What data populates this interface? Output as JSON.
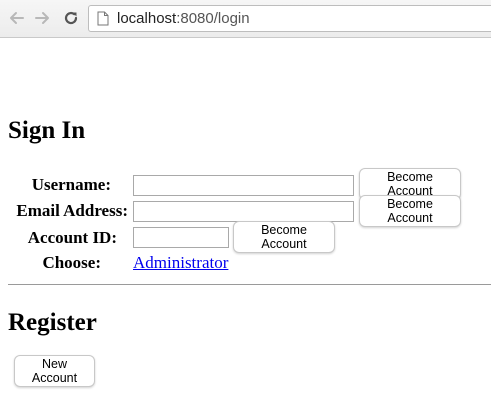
{
  "browser": {
    "url_host": "localhost",
    "url_rest": ":8080/login",
    "icons": {
      "back": "back-arrow-icon",
      "forward": "forward-arrow-icon",
      "reload": "reload-icon",
      "page": "page-icon"
    }
  },
  "signin": {
    "heading": "Sign In",
    "username_label": "Username:",
    "username_value": "",
    "email_label": "Email Address:",
    "email_value": "",
    "account_label": "Account ID:",
    "account_value": "",
    "choose_label": "Choose:",
    "choose_link": "Administrator",
    "become_label": "Become Account"
  },
  "register": {
    "heading": "Register",
    "new_account_label": "New Account"
  },
  "colors": {
    "link": "#0000ee",
    "divider": "#9a9a9a"
  }
}
